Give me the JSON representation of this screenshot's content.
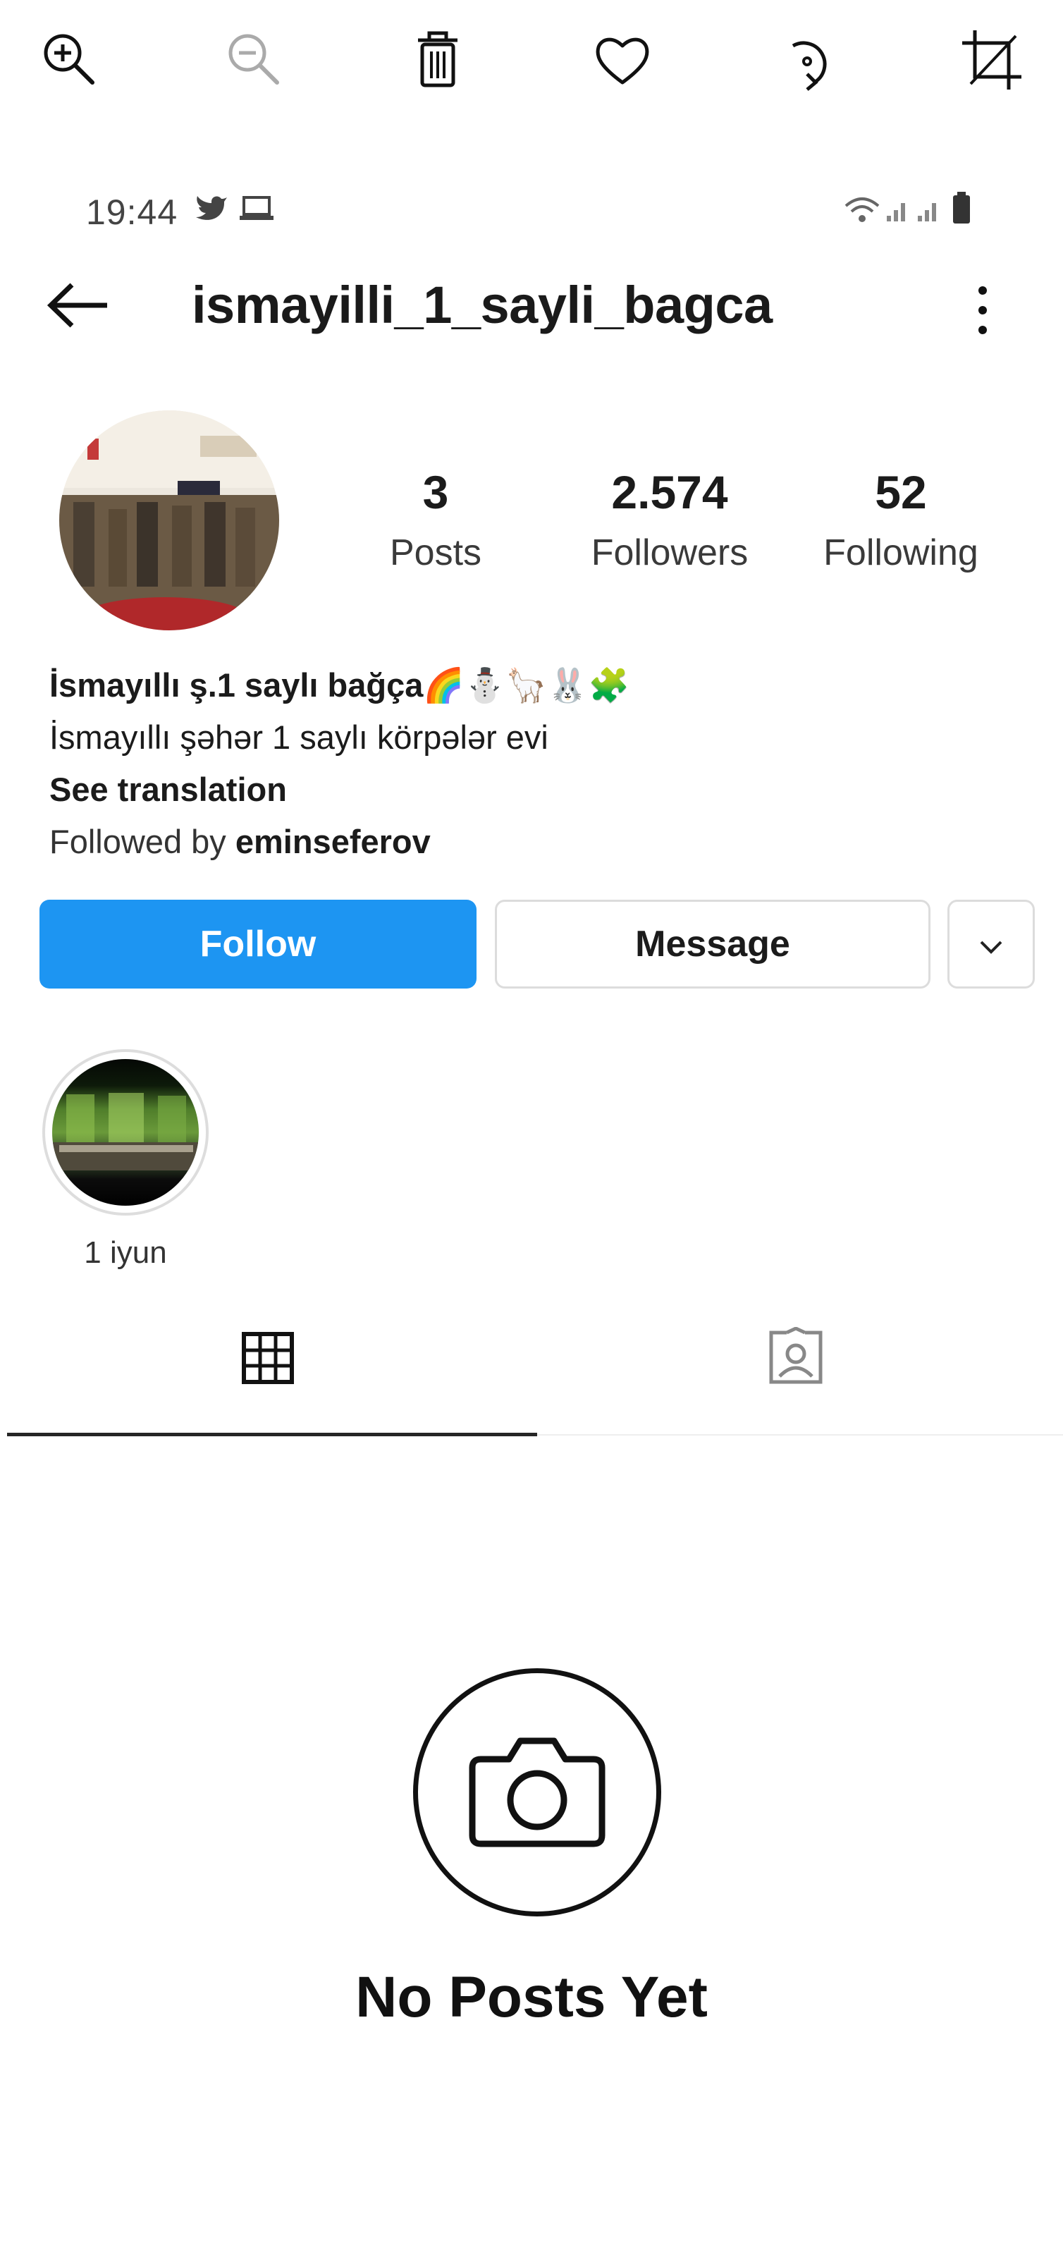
{
  "viewer_toolbar": {
    "icons": [
      "zoom-in-icon",
      "zoom-out-icon",
      "trash-icon",
      "heart-icon",
      "rotate-icon",
      "crop-icon"
    ]
  },
  "status_bar": {
    "time": "19:44",
    "left_icons": [
      "twitter-icon",
      "laptop-icon"
    ],
    "right_icons": [
      "wifi-icon",
      "signal-icon",
      "signal-icon",
      "battery-icon"
    ]
  },
  "header": {
    "username": "ismayilli_1_sayli_bagca",
    "back_icon": "arrow-left-icon",
    "menu_icon": "more-vertical-icon"
  },
  "stats": [
    {
      "value": "3",
      "label": "Posts"
    },
    {
      "value": "2.574",
      "label": "Followers"
    },
    {
      "value": "52",
      "label": "Following"
    }
  ],
  "bio": {
    "name": "İsmayıllı ş.1 saylı bağça🌈⛄🦙🐰🧩",
    "description": "İsmayıllı şəhər 1 saylı körpələr evi",
    "see_translation": "See translation",
    "followed_by_prefix": "Followed by ",
    "followed_by_user": "eminseferov"
  },
  "actions": {
    "follow": "Follow",
    "message": "Message",
    "more_icon": "chevron-down-icon"
  },
  "highlights": [
    {
      "label": "1 iyun"
    }
  ],
  "tabs": [
    {
      "icon": "grid-icon",
      "active": true
    },
    {
      "icon": "tagged-user-icon",
      "active": false
    }
  ],
  "empty_state": {
    "icon": "camera-icon",
    "title": "No Posts Yet"
  },
  "colors": {
    "follow_button": "#1d95f2",
    "text": "#111111"
  }
}
